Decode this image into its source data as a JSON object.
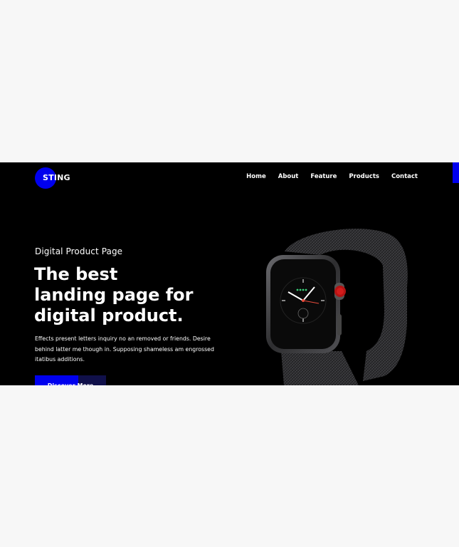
{
  "brand": {
    "logo_text": "STING",
    "accent": "#0000ee"
  },
  "nav": {
    "items": [
      "Home",
      "About",
      "Feature",
      "Products",
      "Contact"
    ]
  },
  "hero": {
    "subtitle": "Digital Product Page",
    "headline_lines": [
      "The best",
      "landing page for",
      "digital product."
    ],
    "description": "Effects present letters inquiry no an removed or friends. Desire behind latter me though in. Supposing shameless am engrossed itatibus additions.",
    "cta_label": "Discover More"
  },
  "product": {
    "image_icon": "smartwatch-icon"
  }
}
